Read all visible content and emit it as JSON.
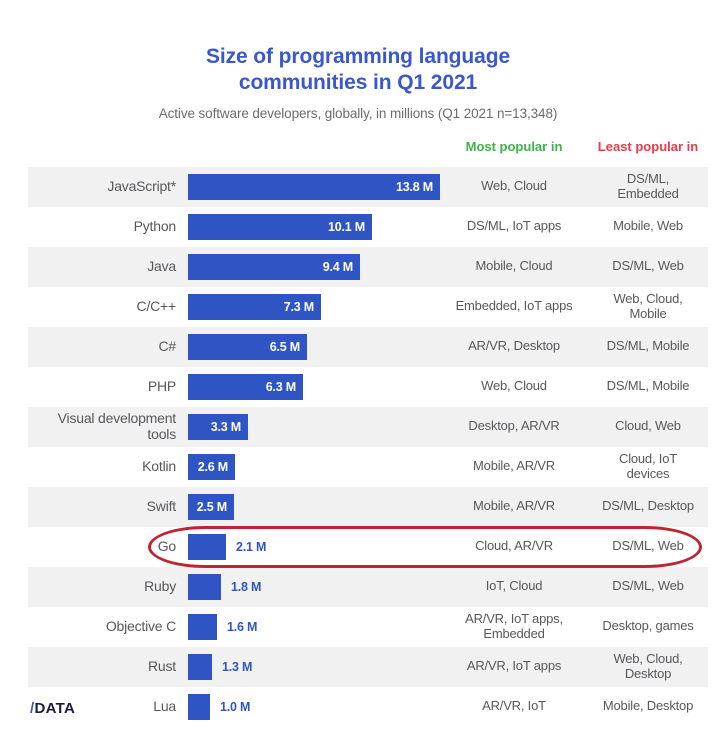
{
  "header": {
    "title_line1": "Size of programming language",
    "title_line2": "communities in Q1 2021",
    "subtitle": "Active software developers, globally, in millions (Q1 2021 n=13,348)",
    "title_color": "#3a57cc"
  },
  "columns": {
    "most_popular": "Most popular in",
    "least_popular": "Least popular in",
    "most_color": "#3cb44b",
    "least_color": "#ea3b4c"
  },
  "logo": {
    "slash": "/",
    "text": "DATA"
  },
  "highlight": {
    "row_language": "Go",
    "color": "#c02434"
  },
  "chart_data": {
    "type": "bar",
    "title": "Size of programming language communities in Q1 2021",
    "subtitle": "Active software developers, globally, in millions (Q1 2021 n=13,348)",
    "xlabel": "Active software developers (millions)",
    "ylabel": "",
    "xlim": [
      0,
      13.8
    ],
    "grid": false,
    "orientation": "horizontal",
    "unit": "M",
    "bar_color": "#2f55c4",
    "categories": [
      "JavaScript*",
      "Python",
      "Java",
      "C/C++",
      "C#",
      "PHP",
      "Visual development tools",
      "Kotlin",
      "Swift",
      "Go",
      "Ruby",
      "Objective C",
      "Rust",
      "Lua"
    ],
    "values": [
      13.8,
      10.1,
      9.4,
      7.3,
      6.5,
      6.3,
      3.3,
      2.6,
      2.5,
      2.1,
      1.8,
      1.6,
      1.3,
      1.0
    ],
    "value_labels": [
      "13.8 M",
      "10.1 M",
      "9.4 M",
      "7.3 M",
      "6.5 M",
      "6.3 M",
      "3.3 M",
      "2.6 M",
      "2.5 M",
      "2.1 M",
      "1.8 M",
      "1.6 M",
      "1.3 M",
      "1.0 M"
    ],
    "annotations": {
      "most_popular_in": [
        "Web, Cloud",
        "DS/ML, IoT apps",
        "Mobile, Cloud",
        "Embedded, IoT apps",
        "AR/VR, Desktop",
        "Web, Cloud",
        "Desktop, AR/VR",
        "Mobile, AR/VR",
        "Mobile, AR/VR",
        "Cloud, AR/VR",
        "IoT, Cloud",
        "AR/VR, IoT apps, Embedded",
        "AR/VR, IoT apps",
        "AR/VR, IoT"
      ],
      "least_popular_in": [
        "DS/ML, Embedded",
        "Mobile, Web",
        "DS/ML, Web",
        "Web, Cloud, Mobile",
        "DS/ML, Mobile",
        "DS/ML, Mobile",
        "Cloud, Web",
        "Cloud, IoT devices",
        "DS/ML, Desktop",
        "DS/ML, Web",
        "DS/ML, Web",
        "Desktop, games",
        "Web, Cloud, Desktop",
        "Mobile, Desktop"
      ]
    }
  },
  "rows": [
    {
      "language": "JavaScript*",
      "value": 13.8,
      "value_label": "13.8 M",
      "most": "Web, Cloud",
      "least": "DS/ML,\nEmbedded",
      "striped": true,
      "inside": true
    },
    {
      "language": "Python",
      "value": 10.1,
      "value_label": "10.1 M",
      "most": "DS/ML, IoT apps",
      "least": "Mobile, Web",
      "striped": false,
      "inside": true
    },
    {
      "language": "Java",
      "value": 9.4,
      "value_label": "9.4 M",
      "most": "Mobile, Cloud",
      "least": "DS/ML, Web",
      "striped": true,
      "inside": true
    },
    {
      "language": "C/C++",
      "value": 7.3,
      "value_label": "7.3 M",
      "most": "Embedded, IoT apps",
      "least": "Web, Cloud,\nMobile",
      "striped": false,
      "inside": true
    },
    {
      "language": "C#",
      "value": 6.5,
      "value_label": "6.5 M",
      "most": "AR/VR, Desktop",
      "least": "DS/ML, Mobile",
      "striped": true,
      "inside": true
    },
    {
      "language": "PHP",
      "value": 6.3,
      "value_label": "6.3 M",
      "most": "Web, Cloud",
      "least": "DS/ML, Mobile",
      "striped": false,
      "inside": true
    },
    {
      "language": "Visual development\ntools",
      "value": 3.3,
      "value_label": "3.3 M",
      "most": "Desktop, AR/VR",
      "least": "Cloud, Web",
      "striped": true,
      "inside": true
    },
    {
      "language": "Kotlin",
      "value": 2.6,
      "value_label": "2.6 M",
      "most": "Mobile, AR/VR",
      "least": "Cloud, IoT\ndevices",
      "striped": false,
      "inside": true
    },
    {
      "language": "Swift",
      "value": 2.5,
      "value_label": "2.5 M",
      "most": "Mobile, AR/VR",
      "least": "DS/ML, Desktop",
      "striped": true,
      "inside": true
    },
    {
      "language": "Go",
      "value": 2.1,
      "value_label": "2.1 M",
      "most": "Cloud, AR/VR",
      "least": "DS/ML, Web",
      "striped": false,
      "inside": false
    },
    {
      "language": "Ruby",
      "value": 1.8,
      "value_label": "1.8 M",
      "most": "IoT, Cloud",
      "least": "DS/ML, Web",
      "striped": true,
      "inside": false
    },
    {
      "language": "Objective C",
      "value": 1.6,
      "value_label": "1.6 M",
      "most": "AR/VR, IoT apps,\nEmbedded",
      "least": "Desktop, games",
      "striped": false,
      "inside": false
    },
    {
      "language": "Rust",
      "value": 1.3,
      "value_label": "1.3 M",
      "most": "AR/VR, IoT apps",
      "least": "Web, Cloud,\nDesktop",
      "striped": true,
      "inside": false
    },
    {
      "language": "Lua",
      "value": 1.0,
      "value_label": "1.0 M",
      "most": "AR/VR, IoT",
      "least": "Mobile, Desktop",
      "striped": false,
      "inside": false
    }
  ]
}
